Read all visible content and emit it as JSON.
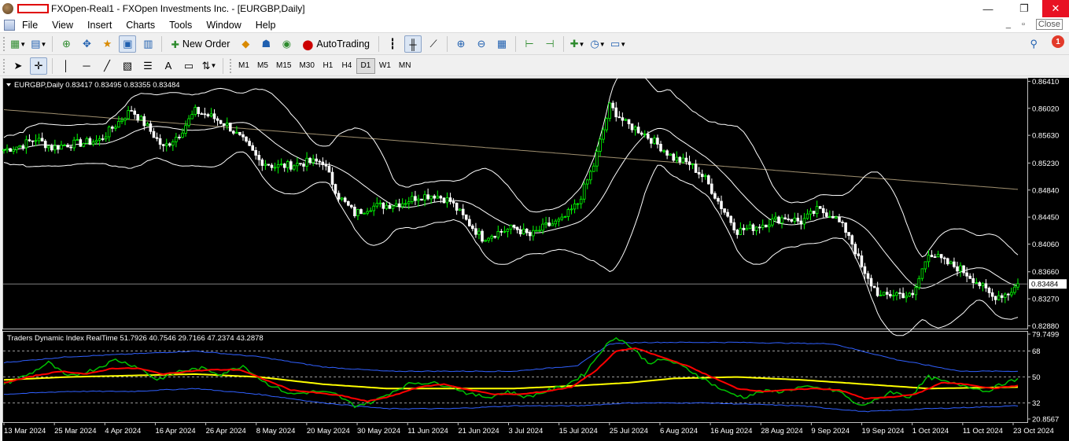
{
  "window": {
    "title": "FXOpen-Real1 - FXOpen Investments Inc. - [EURGBP,Daily]",
    "minimize": "—",
    "maximize": "❐",
    "close": "✕"
  },
  "menu": {
    "items": [
      "File",
      "View",
      "Insert",
      "Charts",
      "Tools",
      "Window",
      "Help"
    ],
    "mdi_min": "_",
    "mdi_max": "▫",
    "mdi_close": "Close"
  },
  "toolbar": {
    "new_order": "New Order",
    "auto_trading": "AutoTrading",
    "notification_count": "1"
  },
  "toolbar2": {
    "text_tool": "A",
    "timeframes": [
      "M1",
      "M5",
      "M15",
      "M30",
      "H1",
      "H4",
      "D1",
      "W1",
      "MN"
    ],
    "active_timeframe": "D1"
  },
  "chart_data": {
    "type": "candlestick",
    "symbol_label": "EURGBP,Daily",
    "ohlc_label": "0.83417 0.83495 0.83355 0.83484",
    "current_price": 0.83484,
    "current_price_label": "0.83484",
    "y_ticks": [
      "0.86410",
      "0.86020",
      "0.85630",
      "0.85230",
      "0.84840",
      "0.84450",
      "0.84060",
      "0.83660",
      "0.83270",
      "0.82880"
    ],
    "y_tick_values": [
      0.8641,
      0.8602,
      0.8563,
      0.8523,
      0.8484,
      0.8445,
      0.8406,
      0.8366,
      0.8327,
      0.8288
    ],
    "ylim": [
      0.8284,
      0.8646
    ],
    "x_ticks": [
      "13 Mar 2024",
      "25 Mar 2024",
      "4 Apr 2024",
      "16 Apr 2024",
      "26 Apr 2024",
      "8 May 2024",
      "20 May 2024",
      "30 May 2024",
      "11 Jun 2024",
      "21 Jun 2024",
      "3 Jul 2024",
      "15 Jul 2024",
      "25 Jul 2024",
      "6 Aug 2024",
      "16 Aug 2024",
      "28 Aug 2024",
      "9 Sep 2024",
      "19 Sep 2024",
      "1 Oct 2024",
      "11 Oct 2024",
      "23 Oct 2024"
    ],
    "colors": {
      "bull": "#00ff00",
      "bear": "#ffffff",
      "bands": "#ffffff",
      "ma": "#a09070",
      "grid_line": "#808080"
    },
    "close_points": [
      [
        0,
        0.8542
      ],
      [
        5,
        0.8548
      ],
      [
        10,
        0.8558
      ],
      [
        15,
        0.8545
      ],
      [
        20,
        0.855
      ],
      [
        25,
        0.8552
      ],
      [
        30,
        0.8556
      ],
      [
        35,
        0.8578
      ],
      [
        40,
        0.86
      ],
      [
        45,
        0.8575
      ],
      [
        50,
        0.8545
      ],
      [
        55,
        0.8565
      ],
      [
        60,
        0.8598
      ],
      [
        65,
        0.859
      ],
      [
        70,
        0.8578
      ],
      [
        75,
        0.8555
      ],
      [
        80,
        0.8527
      ],
      [
        85,
        0.8518
      ],
      [
        90,
        0.852
      ],
      [
        95,
        0.8524
      ],
      [
        100,
        0.8525
      ],
      [
        105,
        0.8475
      ],
      [
        110,
        0.845
      ],
      [
        115,
        0.846
      ],
      [
        120,
        0.8462
      ],
      [
        125,
        0.8466
      ],
      [
        130,
        0.8475
      ],
      [
        135,
        0.8477
      ],
      [
        140,
        0.8468
      ],
      [
        145,
        0.844
      ],
      [
        150,
        0.8415
      ],
      [
        155,
        0.8423
      ],
      [
        160,
        0.843
      ],
      [
        165,
        0.8418
      ],
      [
        170,
        0.8432
      ],
      [
        175,
        0.844
      ],
      [
        180,
        0.8465
      ],
      [
        185,
        0.852
      ],
      [
        190,
        0.8605
      ],
      [
        195,
        0.858
      ],
      [
        200,
        0.8568
      ],
      [
        205,
        0.855
      ],
      [
        210,
        0.853
      ],
      [
        215,
        0.8522
      ],
      [
        220,
        0.85
      ],
      [
        225,
        0.846
      ],
      [
        230,
        0.8425
      ],
      [
        235,
        0.843
      ],
      [
        240,
        0.8438
      ],
      [
        245,
        0.8445
      ],
      [
        250,
        0.8438
      ],
      [
        255,
        0.8455
      ],
      [
        260,
        0.8448
      ],
      [
        265,
        0.842
      ],
      [
        270,
        0.836
      ],
      [
        275,
        0.833
      ],
      [
        280,
        0.8335
      ],
      [
        285,
        0.833
      ],
      [
        290,
        0.8395
      ],
      [
        295,
        0.838
      ],
      [
        300,
        0.837
      ],
      [
        305,
        0.8352
      ],
      [
        310,
        0.833
      ],
      [
        315,
        0.8335
      ],
      [
        318,
        0.8348
      ]
    ],
    "indicator": {
      "name": "Traders Dynamic Index RealTime",
      "values_label": "51.7926 40.7546 29.7166 47.2374 43.2878",
      "label": "Traders Dynamic Index RealTime 51.7926 40.7546 29.7166 47.2374 43.2878",
      "y_ticks": [
        "79.7499",
        "68",
        "50",
        "32",
        "20.8567"
      ],
      "y_tick_values": [
        79.7499,
        68,
        50,
        32,
        20.8567
      ],
      "ylim": [
        20.8567,
        79.7499
      ],
      "levels": [
        68,
        50,
        32
      ],
      "colors": {
        "rsi": "#00c000",
        "signal": "#ff0000",
        "mid": "#ffff00",
        "bands": "#3060ff"
      },
      "rsi_points": [
        [
          0,
          45
        ],
        [
          8,
          52
        ],
        [
          14,
          60
        ],
        [
          20,
          50
        ],
        [
          28,
          55
        ],
        [
          35,
          62
        ],
        [
          42,
          57
        ],
        [
          48,
          48
        ],
        [
          55,
          54
        ],
        [
          62,
          56
        ],
        [
          68,
          52
        ],
        [
          75,
          58
        ],
        [
          82,
          46
        ],
        [
          90,
          38
        ],
        [
          98,
          40
        ],
        [
          104,
          38
        ],
        [
          110,
          30
        ],
        [
          116,
          33
        ],
        [
          122,
          40
        ],
        [
          128,
          46
        ],
        [
          134,
          46
        ],
        [
          140,
          44
        ],
        [
          146,
          38
        ],
        [
          152,
          36
        ],
        [
          158,
          40
        ],
        [
          164,
          36
        ],
        [
          170,
          40
        ],
        [
          176,
          44
        ],
        [
          182,
          52
        ],
        [
          188,
          70
        ],
        [
          192,
          78
        ],
        [
          196,
          72
        ],
        [
          202,
          60
        ],
        [
          208,
          62
        ],
        [
          214,
          56
        ],
        [
          220,
          48
        ],
        [
          226,
          40
        ],
        [
          232,
          36
        ],
        [
          238,
          40
        ],
        [
          244,
          40
        ],
        [
          250,
          43
        ],
        [
          256,
          42
        ],
        [
          262,
          40
        ],
        [
          268,
          30
        ],
        [
          274,
          34
        ],
        [
          278,
          40
        ],
        [
          284,
          36
        ],
        [
          290,
          50
        ],
        [
          296,
          46
        ],
        [
          302,
          44
        ],
        [
          308,
          40
        ],
        [
          314,
          46
        ],
        [
          318,
          48
        ]
      ],
      "signal_points": [
        [
          0,
          46
        ],
        [
          10,
          51
        ],
        [
          18,
          54
        ],
        [
          26,
          52
        ],
        [
          34,
          56
        ],
        [
          42,
          56
        ],
        [
          50,
          52
        ],
        [
          58,
          54
        ],
        [
          66,
          55
        ],
        [
          74,
          55
        ],
        [
          82,
          48
        ],
        [
          90,
          41
        ],
        [
          98,
          39
        ],
        [
          106,
          37
        ],
        [
          114,
          33
        ],
        [
          122,
          37
        ],
        [
          130,
          43
        ],
        [
          138,
          45
        ],
        [
          146,
          41
        ],
        [
          154,
          38
        ],
        [
          162,
          38
        ],
        [
          170,
          40
        ],
        [
          178,
          43
        ],
        [
          186,
          55
        ],
        [
          192,
          68
        ],
        [
          198,
          70
        ],
        [
          206,
          64
        ],
        [
          214,
          58
        ],
        [
          222,
          50
        ],
        [
          230,
          42
        ],
        [
          238,
          40
        ],
        [
          246,
          41
        ],
        [
          254,
          42
        ],
        [
          262,
          41
        ],
        [
          270,
          35
        ],
        [
          278,
          36
        ],
        [
          286,
          38
        ],
        [
          294,
          46
        ],
        [
          302,
          45
        ],
        [
          310,
          42
        ],
        [
          318,
          44
        ]
      ],
      "mid_points": [
        [
          0,
          48
        ],
        [
          20,
          50
        ],
        [
          40,
          51
        ],
        [
          60,
          52
        ],
        [
          80,
          50
        ],
        [
          100,
          45
        ],
        [
          120,
          42
        ],
        [
          140,
          42
        ],
        [
          160,
          42
        ],
        [
          180,
          44
        ],
        [
          196,
          46
        ],
        [
          210,
          49
        ],
        [
          230,
          50
        ],
        [
          250,
          48
        ],
        [
          270,
          45
        ],
        [
          290,
          42
        ],
        [
          318,
          43
        ]
      ],
      "upper_band_points": [
        [
          0,
          60
        ],
        [
          20,
          64
        ],
        [
          40,
          66
        ],
        [
          60,
          68
        ],
        [
          80,
          64
        ],
        [
          100,
          57
        ],
        [
          120,
          54
        ],
        [
          140,
          54
        ],
        [
          160,
          54
        ],
        [
          180,
          58
        ],
        [
          190,
          73
        ],
        [
          200,
          74
        ],
        [
          230,
          74
        ],
        [
          260,
          73
        ],
        [
          280,
          62
        ],
        [
          300,
          54
        ],
        [
          318,
          54
        ]
      ],
      "lower_band_points": [
        [
          0,
          38
        ],
        [
          20,
          40
        ],
        [
          40,
          40
        ],
        [
          60,
          42
        ],
        [
          80,
          38
        ],
        [
          100,
          32
        ],
        [
          120,
          28
        ],
        [
          140,
          28
        ],
        [
          160,
          30
        ],
        [
          180,
          30
        ],
        [
          196,
          32
        ],
        [
          220,
          32
        ],
        [
          250,
          30
        ],
        [
          270,
          26
        ],
        [
          290,
          28
        ],
        [
          318,
          30
        ]
      ]
    }
  }
}
